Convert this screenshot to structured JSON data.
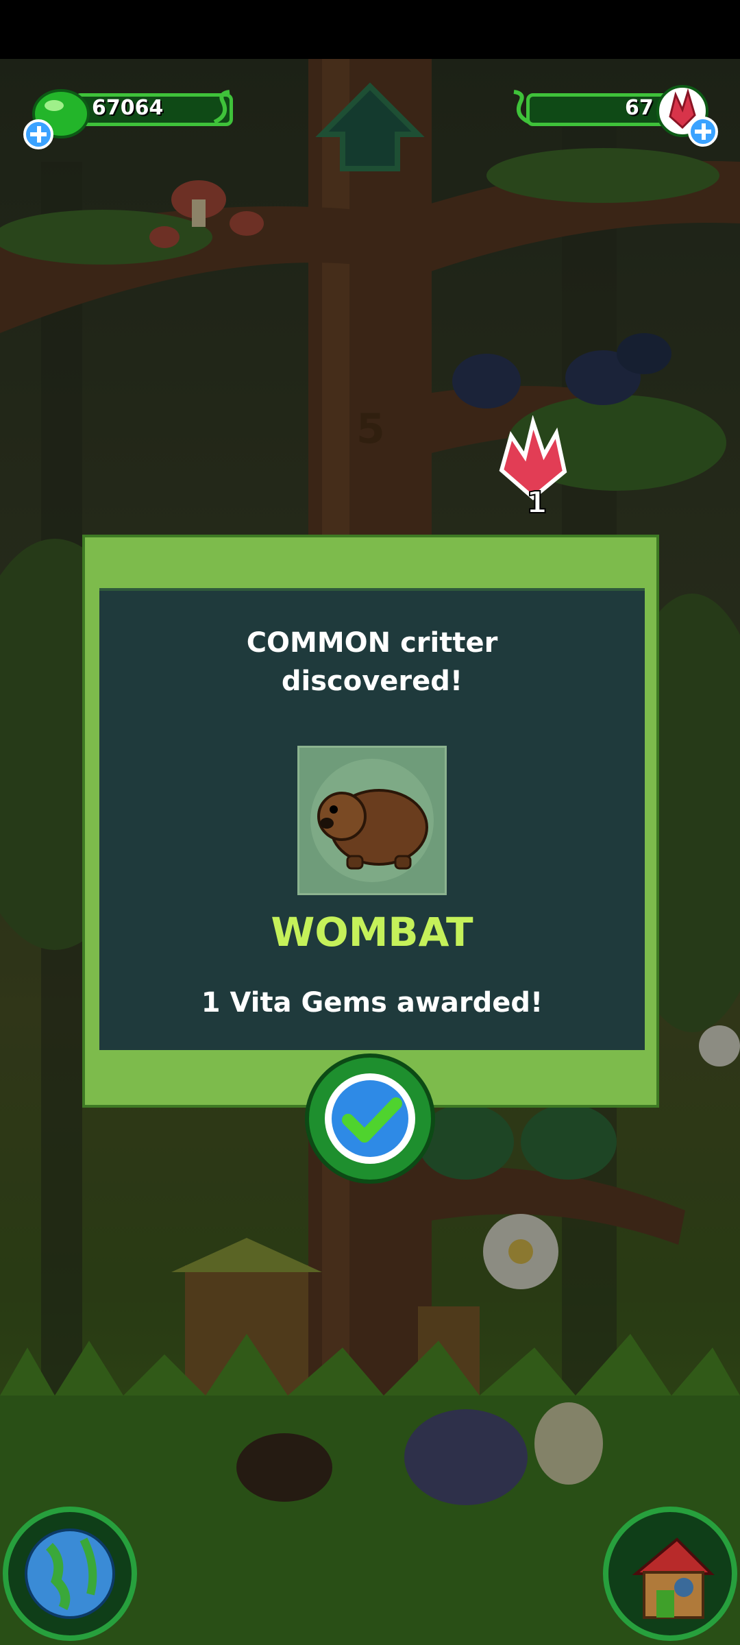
{
  "hud": {
    "vita_count": "67064",
    "gem_count": "67"
  },
  "floating_reward": {
    "gem_amount": "1"
  },
  "dialog": {
    "title_line1": "COMMON critter",
    "title_line2": "discovered!",
    "critter_name": "WOMBAT",
    "award_text": "1 Vita Gems awarded!"
  },
  "icons": [
    "vita-drop-icon",
    "gem-icon",
    "plus-icon",
    "up-arrow-icon",
    "checkmark-icon",
    "globe-icon",
    "house-icon"
  ],
  "colors": {
    "dialog_frame": "#7dbb4c",
    "dialog_panel": "#1f3a3c",
    "critter_name": "#c5f15a",
    "hud_frame": "#3fc23a"
  }
}
